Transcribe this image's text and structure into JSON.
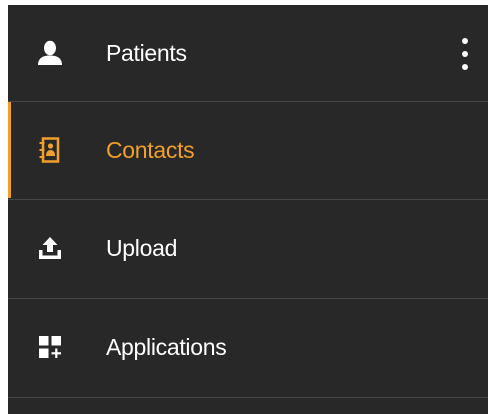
{
  "colors": {
    "panel_bg": "#282828",
    "divider": "#474747",
    "text": "#ffffff",
    "accent": "#f0a02a"
  },
  "sidebar": {
    "items": [
      {
        "label": "Patients",
        "icon": "person-icon",
        "active": false
      },
      {
        "label": "Contacts",
        "icon": "address-book-icon",
        "active": true
      },
      {
        "label": "Upload",
        "icon": "upload-icon",
        "active": false
      },
      {
        "label": "Applications",
        "icon": "apps-add-icon",
        "active": false
      }
    ],
    "more_icon": "more-vertical-icon"
  }
}
